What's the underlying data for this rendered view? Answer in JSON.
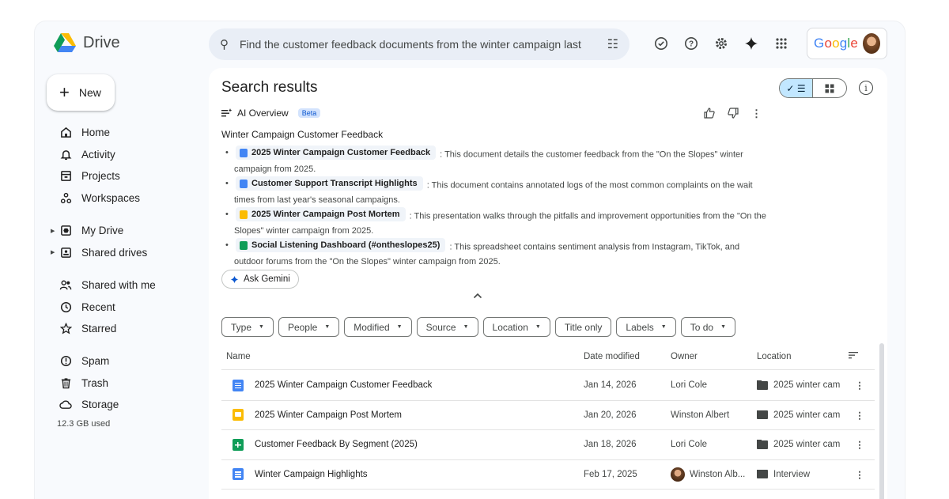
{
  "app": {
    "name": "Drive"
  },
  "search": {
    "query": "Find the customer feedback documents from the winter campaign last"
  },
  "account": {
    "brand": "Google"
  },
  "sidebar": {
    "new_label": "New",
    "items": [
      {
        "label": "Home",
        "icon": "home-icon"
      },
      {
        "label": "Activity",
        "icon": "bell-icon"
      },
      {
        "label": "Projects",
        "icon": "projects-icon"
      },
      {
        "label": "Workspaces",
        "icon": "workspaces-icon"
      },
      {
        "label": "My Drive",
        "icon": "my-drive-icon"
      },
      {
        "label": "Shared drives",
        "icon": "shared-drives-icon"
      },
      {
        "label": "Shared with me",
        "icon": "people-icon"
      },
      {
        "label": "Recent",
        "icon": "clock-icon"
      },
      {
        "label": "Starred",
        "icon": "star-icon"
      },
      {
        "label": "Spam",
        "icon": "spam-icon"
      },
      {
        "label": "Trash",
        "icon": "trash-icon"
      },
      {
        "label": "Storage",
        "icon": "cloud-icon"
      }
    ],
    "storage_used": "12.3 GB used"
  },
  "main": {
    "title": "Search results",
    "ai_overview": {
      "label": "AI Overview",
      "badge": "Beta",
      "heading": "Winter Campaign Customer Feedback",
      "items": [
        {
          "type": "doc",
          "title": "2025 Winter Campaign Customer Feedback",
          "text": ": This document details the customer feedback from the \"On the Slopes\" winter campaign from 2025."
        },
        {
          "type": "doc",
          "title": "Customer Support Transcript Highlights",
          "text": ": This document contains annotated logs of the most common complaints on the wait times from last year's seasonal campaigns."
        },
        {
          "type": "slide",
          "title": "2025 Winter Campaign Post Mortem",
          "text": ": This presentation walks through the pitfalls and improvement opportunities from the \"On the Slopes\" winter campaign from 2025."
        },
        {
          "type": "sheet",
          "title": "Social Listening Dashboard (#ontheslopes25)",
          "text": ": This spreadsheet contains sentiment analysis from Instagram, TikTok, and outdoor forums from the \"On the Slopes\" winter campaign from 2025."
        }
      ],
      "ask_label": "Ask Gemini"
    },
    "filters": [
      "Type",
      "People",
      "Modified",
      "Source",
      "Location",
      "Title only",
      "Labels",
      "To do"
    ],
    "table": {
      "columns": {
        "name": "Name",
        "date": "Date modified",
        "owner": "Owner",
        "location": "Location"
      },
      "rows": [
        {
          "type": "doc",
          "name": "2025 Winter Campaign Customer Feedback",
          "date": "Jan 14, 2026",
          "owner": "Lori Cole",
          "location": "2025 winter cam",
          "avatar": false
        },
        {
          "type": "slide",
          "name": "2025 Winter Campaign Post Mortem",
          "date": "Jan 20, 2026",
          "owner": "Winston Albert",
          "location": "2025 winter cam",
          "avatar": false
        },
        {
          "type": "sheet",
          "name": "Customer Feedback By Segment (2025)",
          "date": "Jan 18, 2026",
          "owner": "Lori Cole",
          "location": "2025 winter cam",
          "avatar": false
        },
        {
          "type": "doc",
          "name": "Winter Campaign Highlights",
          "date": "Feb 17, 2025",
          "owner": "Winston Alb...",
          "location": "Interview",
          "avatar": true
        }
      ]
    }
  },
  "colors": {
    "accent": "#0b57d0",
    "selected": "#c2e7ff",
    "surface": "#f8fafd"
  }
}
